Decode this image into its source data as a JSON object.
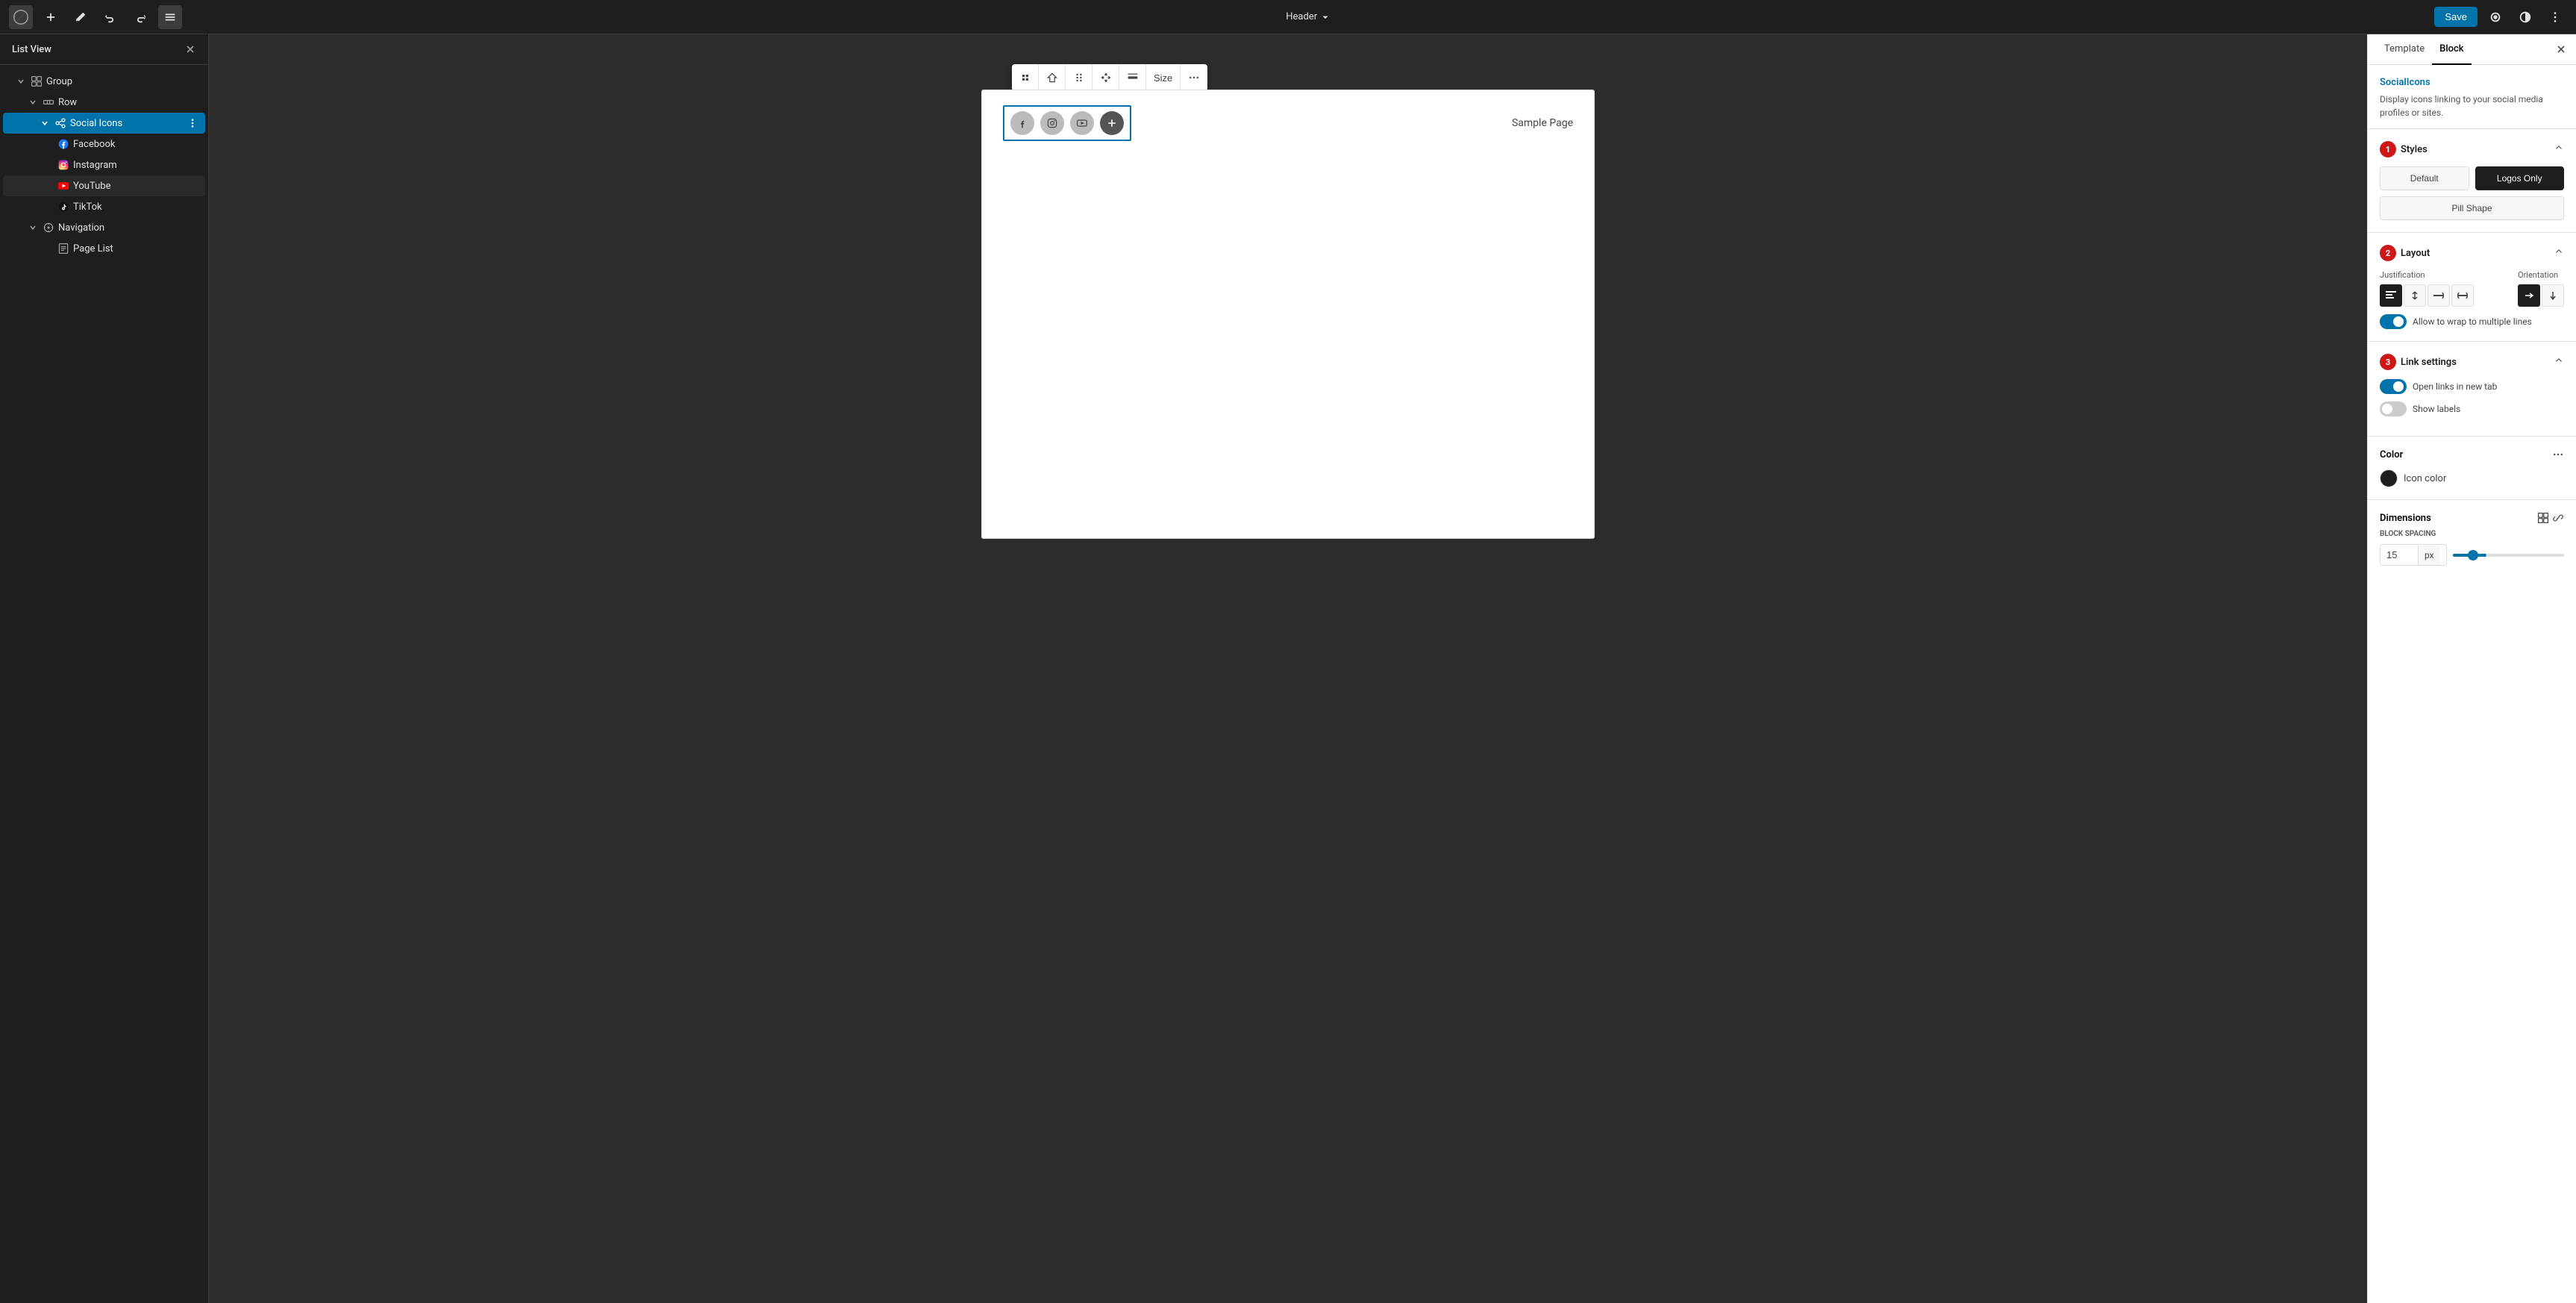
{
  "topbar": {
    "header_label": "Header",
    "save_label": "Save"
  },
  "listview": {
    "title": "List View",
    "items": [
      {
        "id": "group",
        "label": "Group",
        "level": 0,
        "type": "group",
        "expanded": true
      },
      {
        "id": "row",
        "label": "Row",
        "level": 1,
        "type": "row",
        "expanded": true
      },
      {
        "id": "social-icons",
        "label": "Social Icons",
        "level": 2,
        "type": "social",
        "expanded": true,
        "selected": true
      },
      {
        "id": "facebook",
        "label": "Facebook",
        "level": 3,
        "type": "facebook"
      },
      {
        "id": "instagram",
        "label": "Instagram",
        "level": 3,
        "type": "instagram"
      },
      {
        "id": "youtube",
        "label": "YouTube",
        "level": 3,
        "type": "youtube"
      },
      {
        "id": "tiktok",
        "label": "TikTok",
        "level": 3,
        "type": "tiktok"
      },
      {
        "id": "navigation",
        "label": "Navigation",
        "level": 1,
        "type": "navigation",
        "expanded": true
      },
      {
        "id": "page-list",
        "label": "Page List",
        "level": 2,
        "type": "page-list"
      }
    ]
  },
  "canvas": {
    "sample_page": "Sample Page"
  },
  "toolbar": {
    "size_label": "Size"
  },
  "rightpanel": {
    "tabs": [
      "Template",
      "Block"
    ],
    "active_tab": "Block",
    "social_icons_title": "SocialIcons",
    "social_icons_desc": "Display icons linking to your social media profiles or sites.",
    "styles": {
      "title": "Styles",
      "step": "1",
      "options": [
        "Default",
        "Logos Only",
        "Pill Shape"
      ]
    },
    "layout": {
      "title": "Layout",
      "step": "2",
      "justification_label": "Justification",
      "orientation_label": "Orientation",
      "wrap_label": "Allow to wrap to multiple lines"
    },
    "link_settings": {
      "title": "Link settings",
      "step": "3",
      "open_new_tab_label": "Open links in new tab",
      "show_labels_label": "Show labels"
    },
    "color": {
      "title": "Color",
      "icon_color_label": "Icon color"
    },
    "dimensions": {
      "title": "Dimensions",
      "block_spacing_label": "BLOCK SPACING",
      "spacing_value": "15",
      "spacing_unit": "px"
    }
  }
}
